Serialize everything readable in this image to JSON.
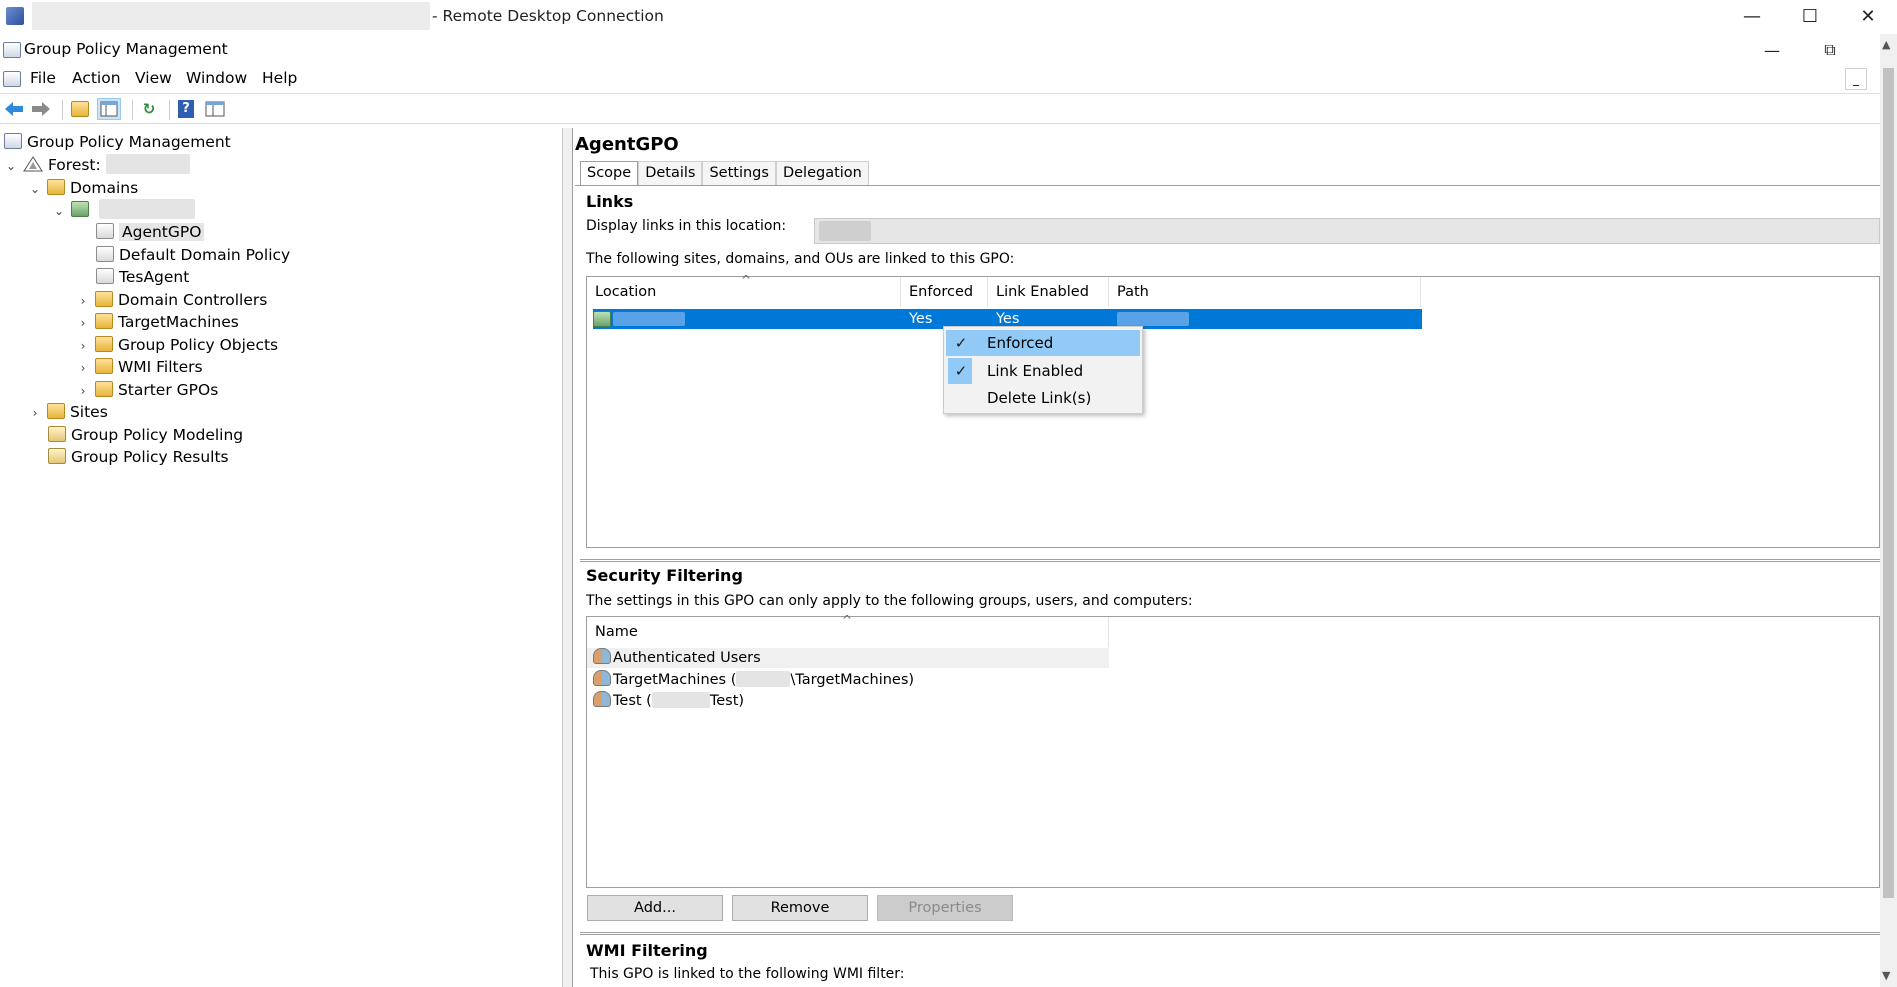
{
  "rdp": {
    "title": "- Remote Desktop Connection",
    "minimize": "—",
    "maximize": "☐",
    "close": "✕"
  },
  "app": {
    "title": "Group Policy Management",
    "minimize": "—",
    "restore": "⧉"
  },
  "menu": [
    "File",
    "Action",
    "View",
    "Window",
    "Help"
  ],
  "toolbar": {
    "back": "back-arrow-icon",
    "forward": "forward-arrow-icon",
    "up": "up-folder-icon",
    "show_hide": "show-hide-tree-icon",
    "refresh": "refresh-icon",
    "help": "help-icon",
    "properties": "properties-icon",
    "help_glyph": "?",
    "refresh_glyph": "↻"
  },
  "tree": {
    "root": "Group Policy Management",
    "forest_label": "Forest:",
    "domains": "Domains",
    "items": [
      "AgentGPO",
      "Default Domain Policy",
      "TesAgent",
      "Domain Controllers",
      "TargetMachines",
      "Group Policy Objects",
      "WMI Filters",
      "Starter GPOs"
    ],
    "sites": "Sites",
    "modeling": "Group Policy Modeling",
    "results": "Group Policy Results"
  },
  "detail": {
    "title": "AgentGPO",
    "tabs": [
      "Scope",
      "Details",
      "Settings",
      "Delegation"
    ],
    "active_tab": "Scope",
    "links": {
      "heading": "Links",
      "display_label": "Display links in this location:",
      "info": "The following sites, domains, and OUs are linked to this GPO:",
      "columns": [
        "Location",
        "Enforced",
        "Link Enabled",
        "Path"
      ],
      "row": {
        "enforced": "Yes",
        "link_enabled": "Yes"
      }
    },
    "context_menu": {
      "items": [
        "Enforced",
        "Link Enabled",
        "Delete Link(s)"
      ],
      "checked": [
        true,
        true,
        false
      ],
      "check_glyph": "✓"
    },
    "security": {
      "heading": "Security Filtering",
      "info": "The settings in this GPO can only apply to the following groups, users, and computers:",
      "column": "Name",
      "rows": [
        {
          "prefix": "Authenticated Users",
          "suffix": ""
        },
        {
          "prefix": "TargetMachines (",
          "suffix": "\\TargetMachines)"
        },
        {
          "prefix": "Test (",
          "suffix": "Test)"
        }
      ],
      "buttons": {
        "add": "Add...",
        "remove": "Remove",
        "properties": "Properties"
      }
    },
    "wmi": {
      "heading": "WMI Filtering",
      "info": "This GPO is linked to the following WMI filter:"
    }
  },
  "colors": {
    "selection": "#0078d7",
    "menu_hover": "#91c9f7"
  }
}
